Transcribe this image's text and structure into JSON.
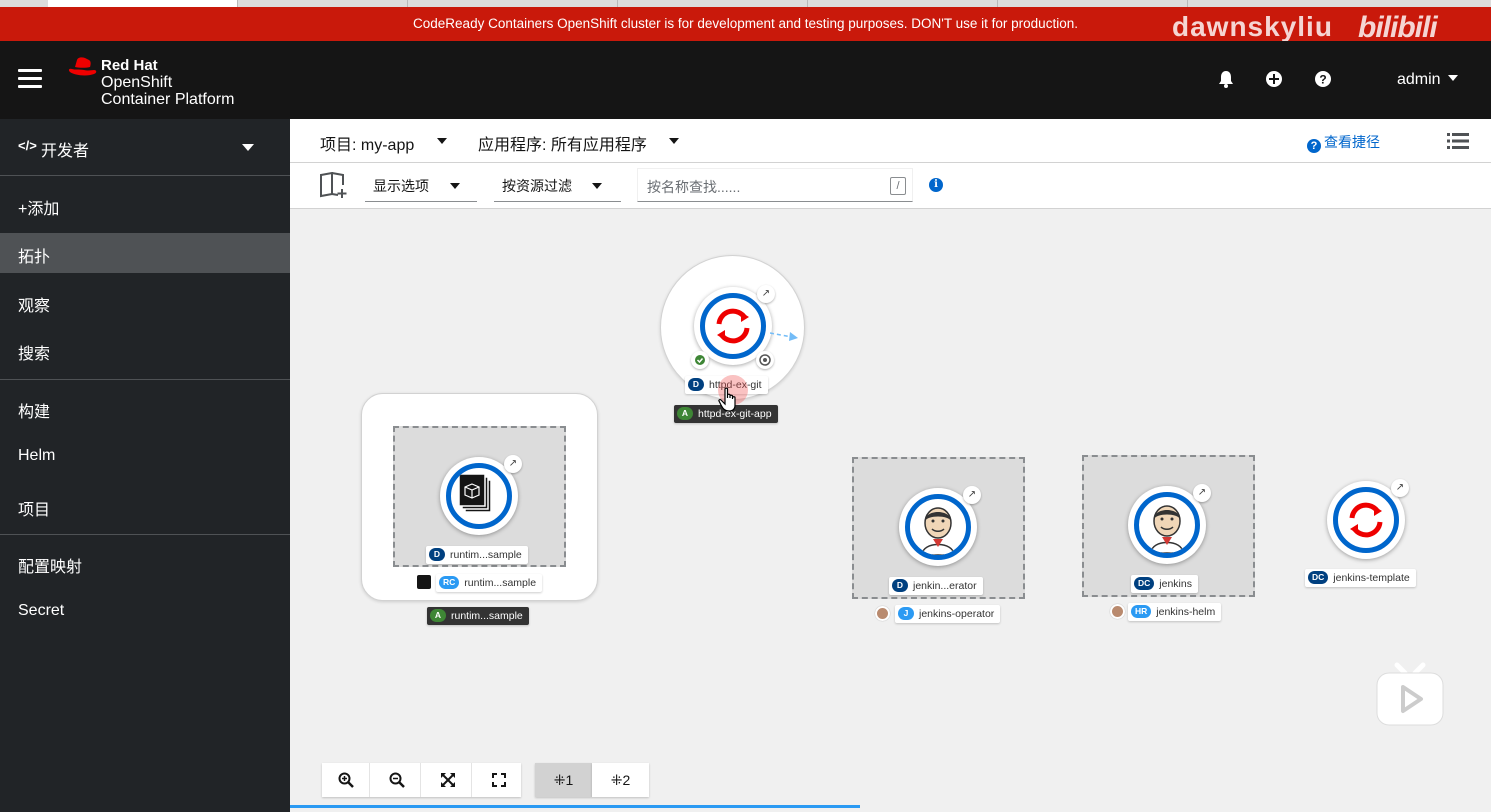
{
  "banner": {
    "text": "CodeReady Containers OpenShift cluster is for development and testing purposes. DON'T use it for production.",
    "watermark_user": "dawnskyliu",
    "watermark_site": "bilibili"
  },
  "masthead": {
    "brand_line1": "Red Hat",
    "brand_line2": "OpenShift",
    "brand_line3": "Container Platform",
    "user": "admin",
    "icons": [
      "bell-icon",
      "plus-circle-icon",
      "question-circle-icon"
    ]
  },
  "sidebar": {
    "perspective": "开发者",
    "items": [
      {
        "label": "+添加"
      },
      {
        "label": "拓扑"
      },
      {
        "label": "观察"
      },
      {
        "label": "搜索"
      },
      {
        "label": "构建"
      },
      {
        "label": "Helm"
      },
      {
        "label": "项目"
      },
      {
        "label": "配置映射"
      },
      {
        "label": "Secret"
      }
    ],
    "active": "拓扑"
  },
  "toolbar": {
    "project": "项目: my-app",
    "application": "应用程序: 所有应用程序",
    "shortcuts": "查看捷径",
    "display_options": "显示选项",
    "filter_by_resource": "按资源过滤",
    "search_placeholder": "按名称查找......",
    "search_shortcut": "/"
  },
  "topology": {
    "nodes": [
      {
        "name": "httpd-ex-git",
        "kind": "D",
        "app": "httpd-ex-git-app",
        "app_kind": "A"
      },
      {
        "name": "runtim...sample",
        "kind": "D",
        "owner_name": "runtim...sample",
        "owner_kind": "RC",
        "app": "runtim...sample",
        "app_kind": "A"
      },
      {
        "name": "jenkin...erator",
        "kind": "D",
        "owner_name": "jenkins-operator",
        "owner_kind": "J"
      },
      {
        "name": "jenkins",
        "kind": "DC",
        "owner_name": "jenkins-helm",
        "owner_kind": "HR"
      },
      {
        "name": "jenkins-template",
        "kind": "DC"
      }
    ],
    "layout_tabs": [
      "1",
      "2"
    ],
    "active_layout": "1"
  },
  "colors": {
    "banner": "#c9190b",
    "masthead": "#151515",
    "sidebar": "#212427",
    "accent": "#0066cc"
  }
}
